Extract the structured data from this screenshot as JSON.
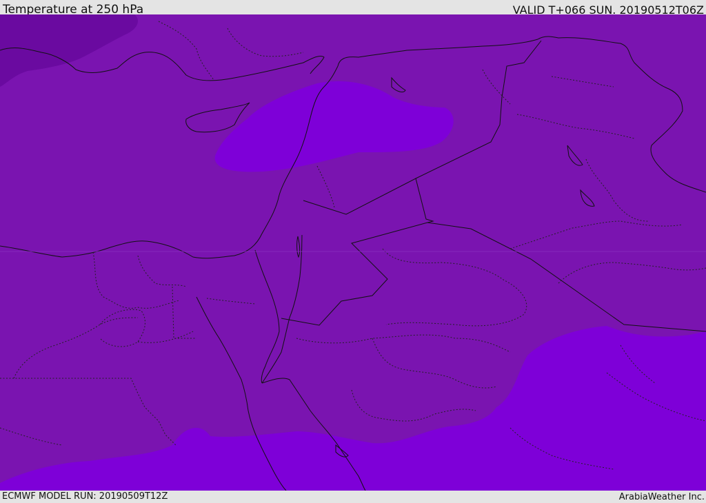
{
  "header": {
    "title": "Temperature at 250 hPa",
    "valid_time": "VALID T+066 SUN. 20190512T06Z"
  },
  "footer": {
    "model_run": "ECMWF MODEL RUN: 20190509T12Z",
    "credit": "ArabiaWeather Inc."
  },
  "map": {
    "field": "temperature",
    "level": "250 hPa",
    "colors": {
      "base": "#7a14b0",
      "cold_band": "#6a0aa0",
      "warm_band": "#7e00d8",
      "borders": "#111111"
    }
  }
}
